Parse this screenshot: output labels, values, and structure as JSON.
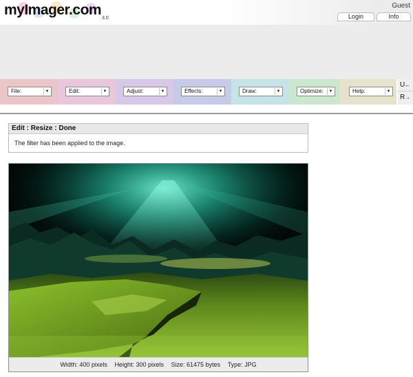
{
  "header": {
    "logo": "myImager.com",
    "version": "3.0",
    "user": "Guest",
    "login_label": "Login",
    "info_label": "Info"
  },
  "menus": [
    {
      "label": "File:",
      "color": "#eac6c8"
    },
    {
      "label": "Edit:",
      "color": "#e8c7dc"
    },
    {
      "label": "Adjust:",
      "color": "#d6c8e6"
    },
    {
      "label": "Effects:",
      "color": "#c8cbe8"
    },
    {
      "label": "Draw:",
      "color": "#c6e4e8"
    },
    {
      "label": "Optimize:",
      "color": "#cbe8cf"
    },
    {
      "label": "Help:",
      "color": "#e6e2cb"
    }
  ],
  "undo": {
    "label": "U",
    "icon": "arrow-left-icon",
    "glyph": "←"
  },
  "redo": {
    "label": "R",
    "icon": "arrow-right-icon",
    "glyph": "→"
  },
  "status": {
    "title": "Edit : Resize : Done",
    "message": "The filter has been applied to the image."
  },
  "image_info": {
    "width": "Width: 400 pixels",
    "height": "Height: 300 pixels",
    "size": "Size: 61475 bytes",
    "type": "Type: JPG"
  }
}
